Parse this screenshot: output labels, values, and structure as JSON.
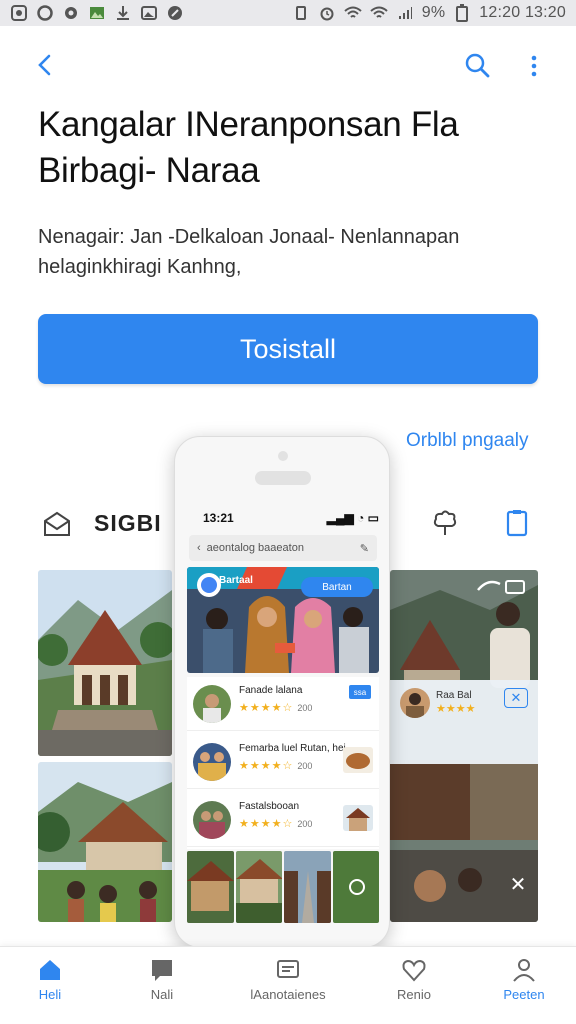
{
  "status_bar": {
    "battery_percent": "9%",
    "time": "12:20 13:20"
  },
  "header": {
    "title": "Kangalar INeranponsan Fla Birbagi- Naraa",
    "description": "Nenagair: Jan -Delkaloan Jonaal- Nenlannapan helaginkhiragi Kanhng,"
  },
  "install": {
    "label": "Tosistall"
  },
  "other_link": "Orblbl pngaaly",
  "feature_row": {
    "label": "SIGBI"
  },
  "phone": {
    "time": "13:21",
    "search_text": "aeontalog baaeaton",
    "banner_text": "Bartaal",
    "banner_button": "Bartan",
    "items": [
      {
        "name": "Fanade lalana",
        "rating": 4.5,
        "count": "200",
        "badge": "ssa"
      },
      {
        "name": "Femarba luel Rutan, hei",
        "rating": 4.5,
        "count": "200"
      },
      {
        "name": "Fastalsbooan",
        "rating": 4.5,
        "count": "200"
      }
    ]
  },
  "overlay": {
    "name": "Raa Bal",
    "rating": 4.0
  },
  "nav": [
    {
      "label": "Heli",
      "icon": "home-icon",
      "active": true
    },
    {
      "label": "Nali",
      "icon": "chat-icon",
      "active": false
    },
    {
      "label": "lAanotaienes",
      "icon": "card-icon",
      "active": false
    },
    {
      "label": "Renio",
      "icon": "heart-icon",
      "active": false
    },
    {
      "label": "Peeten",
      "icon": "person-icon",
      "active": false
    }
  ],
  "colors": {
    "accent": "#2f86ef",
    "star": "#f2b01e"
  }
}
